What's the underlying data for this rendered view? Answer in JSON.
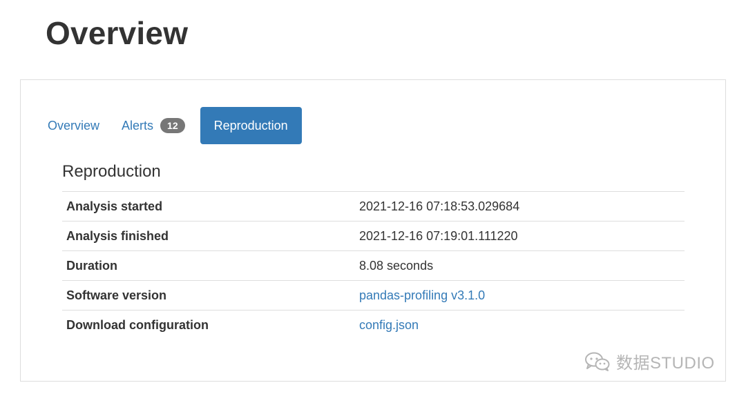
{
  "page": {
    "title": "Overview"
  },
  "tabs": [
    {
      "label": "Overview",
      "active": false
    },
    {
      "label": "Alerts",
      "badge": "12",
      "active": false
    },
    {
      "label": "Reproduction",
      "active": true
    }
  ],
  "reproduction": {
    "heading": "Reproduction",
    "rows": [
      {
        "key": "Analysis started",
        "value": "2021-12-16 07:18:53.029684",
        "link": false
      },
      {
        "key": "Analysis finished",
        "value": "2021-12-16 07:19:01.111220",
        "link": false
      },
      {
        "key": "Duration",
        "value": "8.08 seconds",
        "link": false
      },
      {
        "key": "Software version",
        "value": "pandas-profiling v3.1.0",
        "link": true
      },
      {
        "key": "Download configuration",
        "value": "config.json",
        "link": true
      }
    ]
  },
  "watermark": {
    "text": "数据STUDIO",
    "icon": "wechat-icon"
  },
  "colors": {
    "accent": "#337ab7",
    "badge": "#777777",
    "border": "#dddddd",
    "text": "#333333"
  }
}
